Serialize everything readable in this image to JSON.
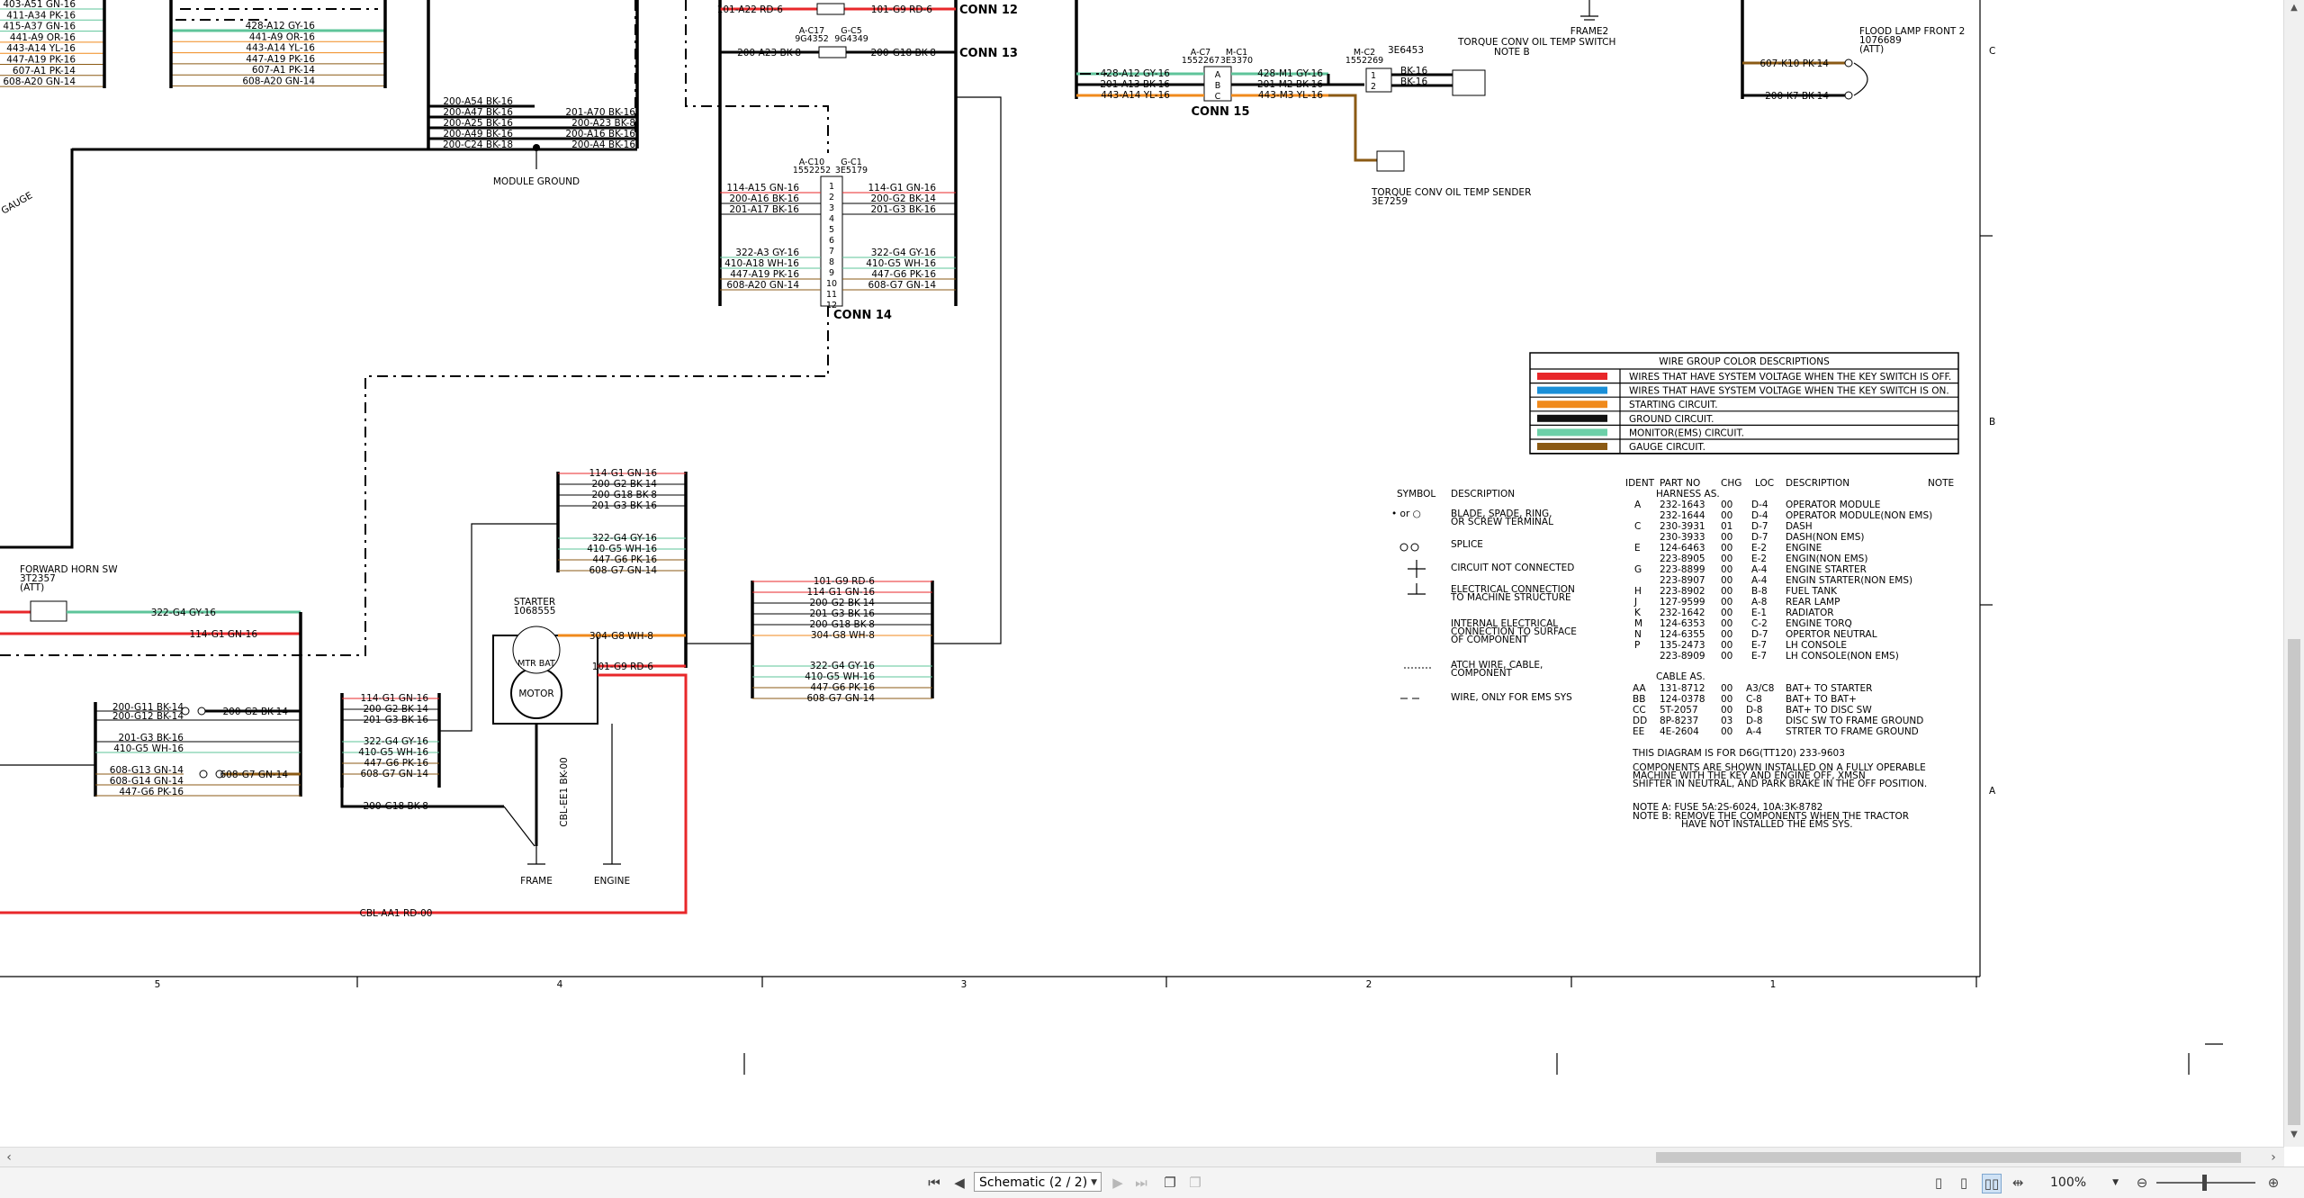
{
  "schematic": {
    "left_wires": [
      "403-A51 GN-16",
      "411-A34 PK-16",
      "415-A37 GN-16",
      "441-A9 OR-16",
      "443-A14 YL-16",
      "447-A19 PK-16",
      "607-A1 PK-14",
      "608-A20 GN-14"
    ],
    "mid_wires": [
      "428-A12 GY-16",
      "441-A9 OR-16",
      "443-A14 YL-16",
      "447-A19 PK-16",
      "607-A1 PK-14",
      "608-A20 GN-14"
    ],
    "module_ground_wires": [
      "200-A54 BK-16",
      "200-A47 BK-16",
      "200-A25 BK-16",
      "200-A49 BK-16",
      "200-C24 BK-18"
    ],
    "module_ground_right": [
      "201-A70 BK-16",
      "200-A23 BK-8",
      "200-A16 BK-16",
      "200-A4 BK-16"
    ],
    "module_ground_label": "MODULE GROUND",
    "gauge_label": "GAUGE",
    "conn12": {
      "label": "CONN 12",
      "left": "101-A22 RD-6",
      "right": "101-G9 RD-6"
    },
    "conn13": {
      "label": "CONN 13",
      "left": "200-A23 BK-8",
      "right": "200-G18 BK-8",
      "part_a": "A-C17",
      "part_a2": "9G4352",
      "part_b": "G-C5",
      "part_b2": "9G4349"
    },
    "conn14": {
      "label": "CONN 14",
      "part_a": "A-C10",
      "part_a2": "1552252",
      "part_b": "G-C1",
      "part_b2": "3E5179",
      "left": [
        "114-A15 GN-16",
        "200-A16 BK-16",
        "201-A17 BK-16",
        "",
        "",
        "",
        "322-A3 GY-16",
        "410-A18 WH-16",
        "447-A19 PK-16",
        "608-A20 GN-14"
      ],
      "right": [
        "114-G1 GN-16",
        "200-G2 BK-14",
        "201-G3 BK-16",
        "",
        "",
        "",
        "322-G4 GY-16",
        "410-G5 WH-16",
        "447-G6 PK-16",
        "608-G7 GN-14"
      ],
      "pins": [
        "1",
        "2",
        "3",
        "4",
        "5",
        "6",
        "7",
        "8",
        "9",
        "10",
        "11",
        "12"
      ]
    },
    "conn15": {
      "label": "CONN 15",
      "part_a": "A-C7",
      "part_a2": "1552267",
      "part_b": "M-C1",
      "part_b2": "3E3370",
      "left": [
        "428-A12 GY-16",
        "201-A13 BK-16",
        "443-A14 YL-16"
      ],
      "right": [
        "428-M1 GY-16",
        "201-M2 BK-16",
        "443-M3 YL-16"
      ],
      "pins": [
        "A",
        "B",
        "C"
      ]
    },
    "mc2": {
      "part": "M-C2",
      "part2": "1552269",
      "pins": [
        "1",
        "2"
      ],
      "wires": [
        "BK-16",
        "BK-16"
      ]
    },
    "oil_switch": {
      "title": "TORQUE CONV OIL TEMP SWITCH",
      "part": "3E6453",
      "note": "NOTE B"
    },
    "oil_sender": {
      "title": "TORQUE CONV OIL TEMP SENDER",
      "part": "3E7259"
    },
    "frame2": "FRAME2",
    "flood_lamp": {
      "title": "FLOOD LAMP FRONT 2",
      "part": "1076689",
      "att": "(ATT)",
      "wires": [
        "607-K10 PK-14",
        "200-K7 BK-14"
      ]
    },
    "forward_horn": {
      "title": "FORWARD HORN SW",
      "part": "3T2357",
      "att": "(ATT)",
      "wire": "322-G4 GY-16",
      "wire2": "114-G1 GN-16"
    },
    "g_block_top": [
      "114-G1 GN-16",
      "200-G2 BK-14",
      "200-G18 BK-8",
      "201-G3 BK-16",
      "322-G4 GY-16",
      "410-G5 WH-16",
      "447-G6 PK-16",
      "608-G7 GN-14"
    ],
    "g_block_right": [
      "101-G9 RD-6",
      "114-G1 GN-16",
      "200-G2 BK-14",
      "201-G3 BK-16",
      "200-G18 BK-8",
      "304-G8 WH-8",
      "322-G4 GY-16",
      "410-G5 WH-16",
      "447-G6 PK-16",
      "608-G7 GN-14"
    ],
    "g_block_mid": [
      "114-G1 GN-16",
      "200-G2 BK-14",
      "201-G3 BK-16",
      "322-G4 GY-16",
      "410-G5 WH-16",
      "447-G6 PK-16",
      "608-G7 GN-14",
      "200-G18 BK-8"
    ],
    "g_block_left": [
      "200-G11 BK-14",
      "200-G12 BK-14",
      "201-G3 BK-16",
      "410-G5 WH-16",
      "608-G13 GN-14",
      "608-G14 GN-14",
      "447-G6 PK-16"
    ],
    "g_block_left_r": [
      "200-G2 BK-14",
      "608-G7 GN-14"
    ],
    "starter": {
      "title": "STARTER",
      "part": "1068555",
      "motor": "MOTOR",
      "mtr_bat": "MTR BAT",
      "wire1": "304-G8 WH-8",
      "wire2": "101-G9 RD-6",
      "cable": "CBL-EE1 BK-00",
      "frame": "FRAME",
      "engine": "ENGINE"
    },
    "cable_bottom": "CBL-AA1 RD-00",
    "col_markers": [
      "5",
      "4",
      "3",
      "2",
      "1"
    ],
    "row_markers": [
      "C",
      "B",
      "A"
    ],
    "color_table": {
      "title": "WIRE GROUP COLOR DESCRIPTIONS",
      "rows": [
        {
          "color": "#e8272a",
          "text": "WIRES THAT HAVE SYSTEM VOLTAGE WHEN THE KEY SWITCH IS OFF."
        },
        {
          "color": "#1a8fd8",
          "text": "WIRES THAT HAVE SYSTEM VOLTAGE WHEN THE KEY SWITCH IS ON."
        },
        {
          "color": "#f08a1c",
          "text": "STARTING CIRCUIT."
        },
        {
          "color": "#111111",
          "text": "GROUND CIRCUIT."
        },
        {
          "color": "#6cd0a8",
          "text": "MONITOR(EMS) CIRCUIT."
        },
        {
          "color": "#8b5a14",
          "text": "GAUGE CIRCUIT."
        }
      ]
    },
    "symbol_legend": {
      "header_symbol": "SYMBOL",
      "header_desc": "DESCRIPTION",
      "items": [
        {
          "sym": "• or ○",
          "lines": [
            "BLADE, SPADE, RING,",
            "OR SCREW TERMINAL"
          ]
        },
        {
          "sym": "",
          "lines": [
            "SPLICE"
          ]
        },
        {
          "sym": "",
          "lines": [
            "CIRCUIT NOT CONNECTED"
          ]
        },
        {
          "sym": "",
          "lines": [
            "ELECTRICAL CONNECTION",
            "TO MACHINE STRUCTURE"
          ]
        },
        {
          "sym": "",
          "lines": [
            "INTERNAL ELECTRICAL",
            "CONNECTION TO SURFACE",
            "OF COMPONENT"
          ]
        },
        {
          "sym": "",
          "lines": [
            "ATCH WIRE, CABLE,",
            "COMPONENT"
          ]
        },
        {
          "sym": "",
          "lines": [
            "WIRE, ONLY FOR EMS SYS"
          ]
        }
      ]
    },
    "harness_table": {
      "headers": [
        "IDENT",
        "PART NO",
        "CHG",
        "LOC",
        "DESCRIPTION",
        "NOTE"
      ],
      "section1": "HARNESS AS.",
      "rows": [
        [
          "A",
          "232-1643",
          "00",
          "D-4",
          "OPERATOR MODULE"
        ],
        [
          "",
          "232-1644",
          "00",
          "D-4",
          "OPERATOR MODULE(NON EMS)"
        ],
        [
          "C",
          "230-3931",
          "01",
          "D-7",
          "DASH"
        ],
        [
          "",
          "230-3933",
          "00",
          "D-7",
          "DASH(NON EMS)"
        ],
        [
          "E",
          "124-6463",
          "00",
          "E-2",
          "ENGINE"
        ],
        [
          "",
          "223-8905",
          "00",
          "E-2",
          "ENGIN(NON EMS)"
        ],
        [
          "G",
          "223-8899",
          "00",
          "A-4",
          "ENGINE STARTER"
        ],
        [
          "",
          "223-8907",
          "00",
          "A-4",
          "ENGIN STARTER(NON EMS)"
        ],
        [
          "H",
          "223-8902",
          "00",
          "B-8",
          "FUEL TANK"
        ],
        [
          "J",
          "127-9599",
          "00",
          "A-8",
          "REAR LAMP"
        ],
        [
          "K",
          "232-1642",
          "00",
          "E-1",
          "RADIATOR"
        ],
        [
          "M",
          "124-6353",
          "00",
          "C-2",
          "ENGINE TORQ"
        ],
        [
          "N",
          "124-6355",
          "00",
          "D-7",
          "OPERTOR NEUTRAL"
        ],
        [
          "P",
          "135-2473",
          "00",
          "E-7",
          "LH CONSOLE"
        ],
        [
          "",
          "223-8909",
          "00",
          "E-7",
          "LH CONSOLE(NON EMS)"
        ]
      ],
      "section2": "CABLE AS.",
      "cable_rows": [
        [
          "AA",
          "131-8712",
          "00",
          "A3/C8",
          "BAT+ TO STARTER"
        ],
        [
          "BB",
          "124-0378",
          "00",
          "C-8",
          "BAT+ TO BAT+"
        ],
        [
          "CC",
          "5T-2057",
          "00",
          "D-8",
          "BAT+ TO DISC SW"
        ],
        [
          "DD",
          "8P-8237",
          "03",
          "D-8",
          "DISC SW TO FRAME GROUND"
        ],
        [
          "EE",
          "4E-2604",
          "00",
          "A-4",
          "STRTER TO FRAME GROUND"
        ]
      ],
      "diagram_for": "THIS DIAGRAM IS FOR D6G(TT120)   233-9603",
      "notes": [
        "COMPONENTS ARE SHOWN INSTALLED ON A FULLY OPERABLE",
        "MACHINE WITH THE KEY AND ENGINE OFF, XMSN",
        "SHIFTER IN NEUTRAL, AND PARK BRAKE  IN THE OFF POSITION."
      ],
      "note_a": "NOTE A:  FUSE  5A:2S-6024, 10A:3K-8782",
      "note_b": [
        "NOTE B:  REMOVE THE COMPONENTS WHEN THE TRACTOR",
        "HAVE NOT INSTALLED THE EMS SYS."
      ]
    }
  },
  "toolbar": {
    "page_selector": "Schematic (2 / 2)",
    "zoom_level": "100%",
    "first_icon": "first-page-icon",
    "prev_icon": "previous-page-icon",
    "next_icon": "next-page-icon",
    "last_icon": "last-page-icon"
  }
}
